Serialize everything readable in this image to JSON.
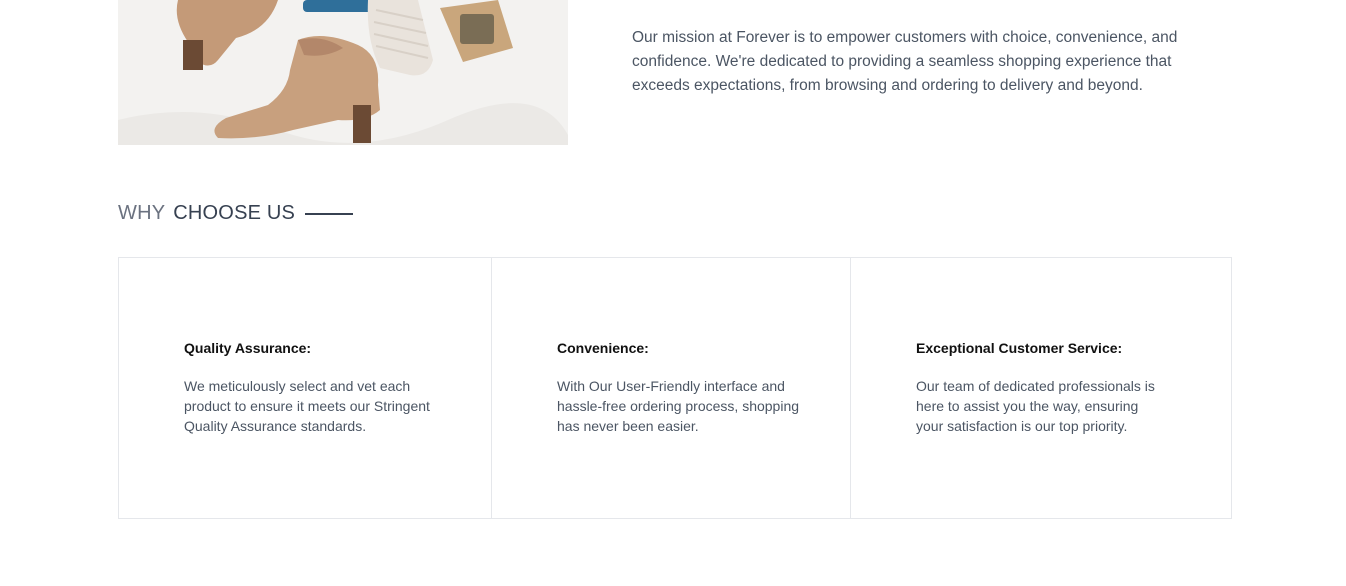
{
  "about": {
    "mission_text": "Our mission at Forever is to empower customers with choice, convenience, and confidence. We're dedicated to providing a seamless shopping experience that exceeds expectations, from browsing and ordering to delivery and beyond."
  },
  "why_choose_us": {
    "title_light": "WHY",
    "title_bold": "CHOOSE US",
    "features": [
      {
        "title": "Quality Assurance:",
        "text": "We meticulously select and vet each product to ensure it meets our Stringent Quality Assurance standards."
      },
      {
        "title": "Convenience:",
        "text": "With Our User-Friendly interface and hassle-free ordering process, shopping has never been easier."
      },
      {
        "title": "Exceptional Customer Service:",
        "text": "Our team of dedicated professionals is here to assist you the way, ensuring your satisfaction is our top priority."
      }
    ]
  }
}
